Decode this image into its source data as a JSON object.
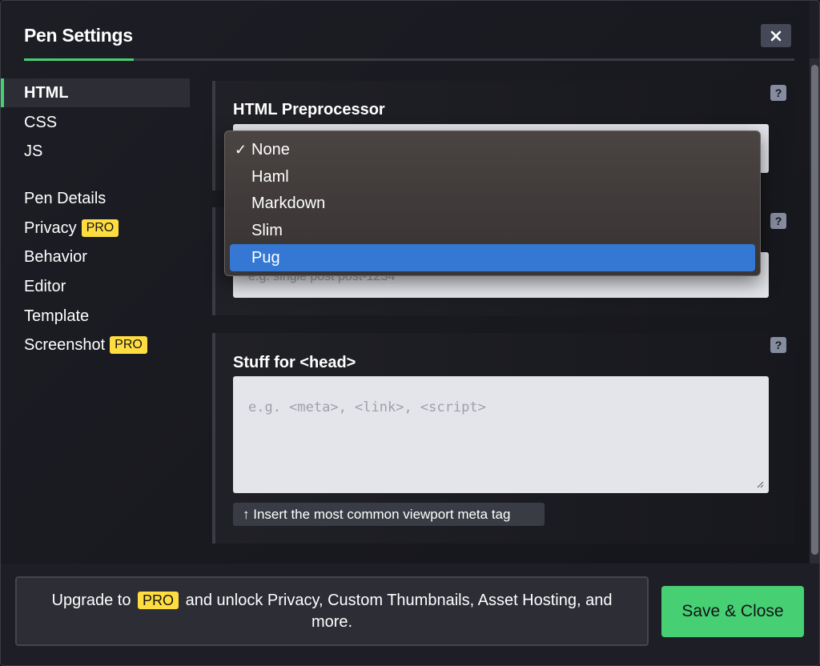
{
  "header": {
    "title": "Pen Settings"
  },
  "sidebar": {
    "items": [
      {
        "label": "HTML"
      },
      {
        "label": "CSS"
      },
      {
        "label": "JS"
      },
      {
        "label": "Pen Details"
      },
      {
        "label": "Privacy"
      },
      {
        "label": "Behavior"
      },
      {
        "label": "Editor"
      },
      {
        "label": "Template"
      },
      {
        "label": "Screenshot"
      }
    ],
    "pro_badge": "PRO"
  },
  "sections": {
    "preprocessor": {
      "label": "HTML Preprocessor",
      "help": "?"
    },
    "classes": {
      "placeholder": "e.g. single post post-1234",
      "help": "?"
    },
    "head": {
      "label": "Stuff for <head>",
      "placeholder": "e.g. <meta>, <link>, <script>",
      "help": "?",
      "insert_button": "↑ Insert the most common viewport meta tag"
    }
  },
  "dropdown": {
    "check": "✓",
    "options": [
      "None",
      "Haml",
      "Markdown",
      "Slim",
      "Pug"
    ],
    "checked_value": "None",
    "highlighted_value": "Pug"
  },
  "footer": {
    "upgrade_before": "Upgrade to",
    "upgrade_badge": "PRO",
    "upgrade_after": "and unlock Privacy, Custom Thumbnails, Asset Hosting, and more.",
    "save_button": "Save & Close"
  },
  "colors": {
    "accent_green": "#47cf73",
    "pro_yellow": "#ffdd40",
    "highlight_blue": "#3478d4"
  }
}
